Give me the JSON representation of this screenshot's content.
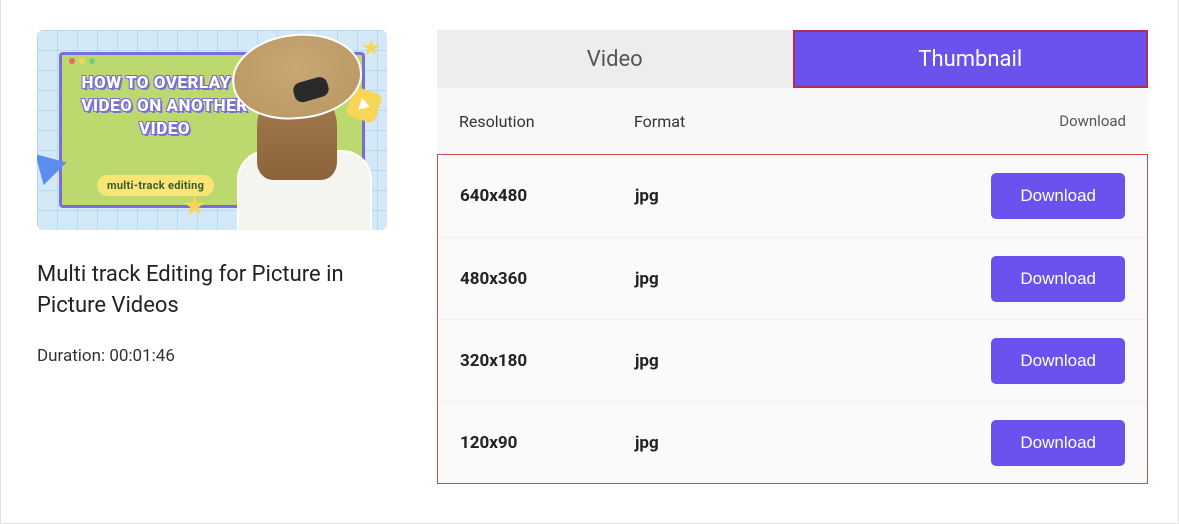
{
  "video": {
    "title": "Multi track Editing for Picture in Picture Videos",
    "duration_label": "Duration: 00:01:46",
    "thumb_overlay_title": "HOW TO OVERLAY A VIDEO ON ANOTHER VIDEO",
    "thumb_overlay_subtitle": "multi-track editing"
  },
  "tabs": {
    "video_label": "Video",
    "thumbnail_label": "Thumbnail",
    "active": "thumbnail"
  },
  "headers": {
    "resolution": "Resolution",
    "format": "Format",
    "download": "Download"
  },
  "rows": [
    {
      "resolution": "640x480",
      "format": "jpg",
      "button": "Download"
    },
    {
      "resolution": "480x360",
      "format": "jpg",
      "button": "Download"
    },
    {
      "resolution": "320x180",
      "format": "jpg",
      "button": "Download"
    },
    {
      "resolution": "120x90",
      "format": "jpg",
      "button": "Download"
    }
  ]
}
